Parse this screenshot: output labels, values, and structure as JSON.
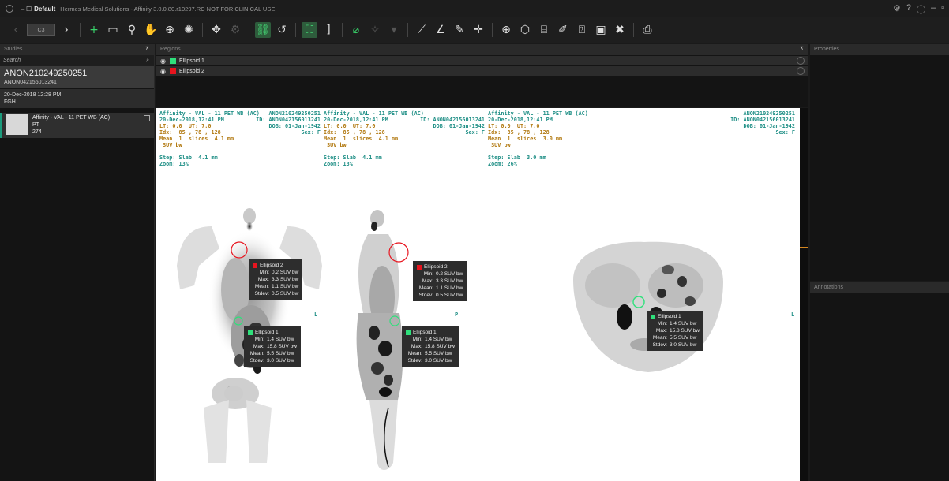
{
  "titlebar": {
    "layout_icon": "→☐",
    "layout_name": "Default",
    "app_title": "Hermes Medical Solutions - Affinity 3.0.0.80.r10297.RC NOT FOR CLINICAL USE",
    "controls": [
      "⚙",
      "?",
      "ⓘ",
      "–",
      "▫"
    ]
  },
  "toolbar": {
    "series_selector_label": "C3"
  },
  "panels": {
    "studies_header": "Studies",
    "regions_header": "Regions",
    "properties_header": "Properties",
    "annotations_header": "Annotations",
    "pin_glyph": "⊼"
  },
  "studies": {
    "search_placeholder": "Search",
    "patient_name": "ANON210249250251",
    "patient_id": "ANON042156013241",
    "study_date": "20-Dec-2018 12:28 PM",
    "study_site": "FGH",
    "series_description": "Affinity - VAL - 11 PET WB (AC)",
    "series_modality": "PT",
    "series_count": "274"
  },
  "regions": [
    {
      "name": "Ellipsoid 1",
      "color": "#2fe07b"
    },
    {
      "name": "Ellipsoid 2",
      "color": "#e8141e"
    }
  ],
  "viewports": [
    {
      "line1_left": "Affinity - VAL - 11 PET WB (AC)",
      "line1_right": "ANON210249250251",
      "line2_left": "20-Dec-2018,12:41 PM",
      "line2_right": "ID: ANON042156013241",
      "line3_left": "LT: 0.0  UT: 7.0",
      "line3_right": "DOB: 01-Jan-1942",
      "line4_left": "Idx:  85 , 78 , 128",
      "line4_right": "Sex: F",
      "line5": "Mean  1  slices  4.1 mm",
      "line6": " SUV bw",
      "step": "Step: Slab  4.1 mm",
      "zoom": "Zoom: 13%",
      "orientation": "L"
    },
    {
      "line1_left": "Affinity - VAL - 11 PET WB (AC)",
      "line1_right": "ANON210249250251",
      "line2_left": "20-Dec-2018,12:41 PM",
      "line2_right": "ID: ANON042156013241",
      "line3_left": "LT: 0.0  UT: 7.0",
      "line3_right": "DOB: 01-Jan-1942",
      "line4_left": "Idx:  85 , 78 , 128",
      "line4_right": "Sex: F",
      "line5": "Mean  1  slices  4.1 mm",
      "line6": " SUV bw",
      "step": "Step: Slab  4.1 mm",
      "zoom": "Zoom: 13%",
      "orientation": "P"
    },
    {
      "line1_left": "Affinity - VAL - 11 PET WB (AC)",
      "line1_right": "ANON210249250251",
      "line2_left": "20-Dec-2018,12:41 PM",
      "line2_right": "ID: ANON042156013241",
      "line3_left": "LT: 0.0  UT: 7.0",
      "line3_right": "DOB: 01-Jan-1942",
      "line4_left": "Idx:  85 , 78 , 128",
      "line4_right": "Sex: F",
      "line5": "Mean  1  slices  3.0 mm",
      "line6": " SUV bw",
      "step": "Step: Slab  3.0 mm",
      "zoom": "Zoom: 26%",
      "orientation": "L"
    }
  ],
  "stats": {
    "e2": {
      "name": "Ellipsoid 2",
      "min": "0.2 SUV bw",
      "max": "3.3 SUV bw",
      "mean": "1.1 SUV bw",
      "stdev": "0.5 SUV bw"
    },
    "e1": {
      "name": "Ellipsoid 1",
      "min": "1.4 SUV bw",
      "max": "15.8 SUV bw",
      "mean": "5.5 SUV bw",
      "stdev": "3.0 SUV bw"
    },
    "labels": {
      "min": "Min:",
      "max": "Max:",
      "mean": "Mean:",
      "stdev": "Stdev:"
    }
  }
}
